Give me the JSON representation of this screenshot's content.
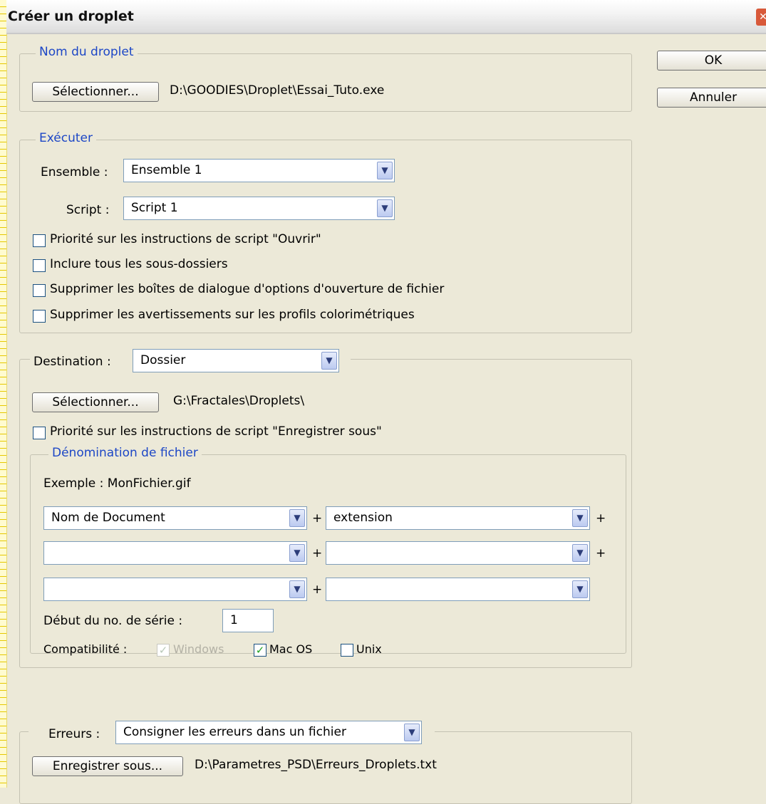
{
  "window": {
    "title": "Créer un droplet"
  },
  "buttons": {
    "ok": "OK",
    "cancel": "Annuler"
  },
  "droplet_name": {
    "legend": "Nom du droplet",
    "select_button": "Sélectionner...",
    "path": "D:\\GOODIES\\Droplet\\Essai_Tuto.exe"
  },
  "execute": {
    "legend": "Exécuter",
    "set_label": "Ensemble :",
    "set_value": "Ensemble 1",
    "script_label": "Script :",
    "script_value": "Script 1",
    "options": [
      {
        "label": "Priorité sur les instructions de script \"Ouvrir\"",
        "checked": false
      },
      {
        "label": "Inclure tous les sous-dossiers",
        "checked": false
      },
      {
        "label": "Supprimer les boîtes de dialogue d'options d'ouverture de fichier",
        "checked": false
      },
      {
        "label": "Supprimer les avertissements sur les profils colorimétriques",
        "checked": false
      }
    ]
  },
  "destination": {
    "label": "Destination :",
    "value": "Dossier",
    "select_button": "Sélectionner...",
    "path": "G:\\Fractales\\Droplets\\",
    "override_label": "Priorité sur les instructions de script \"Enregistrer sous\"",
    "override_checked": false
  },
  "file_naming": {
    "legend": "Dénomination de fichier",
    "example": "Exemple : MonFichier.gif",
    "rows": [
      {
        "left": "Nom de Document",
        "right": "extension"
      },
      {
        "left": "",
        "right": ""
      },
      {
        "left": "",
        "right": ""
      }
    ],
    "plus": "+",
    "serial_label": "Début du no. de série :",
    "serial_value": "1",
    "compat_label": "Compatibilité :",
    "compat_windows": "Windows",
    "compat_mac": "Mac OS",
    "compat_unix": "Unix"
  },
  "errors": {
    "label": "Erreurs :",
    "value": "Consigner les erreurs dans un fichier",
    "save_button": "Enregistrer sous...",
    "path": "D:\\Parametres_PSD\\Erreurs_Droplets.txt"
  }
}
